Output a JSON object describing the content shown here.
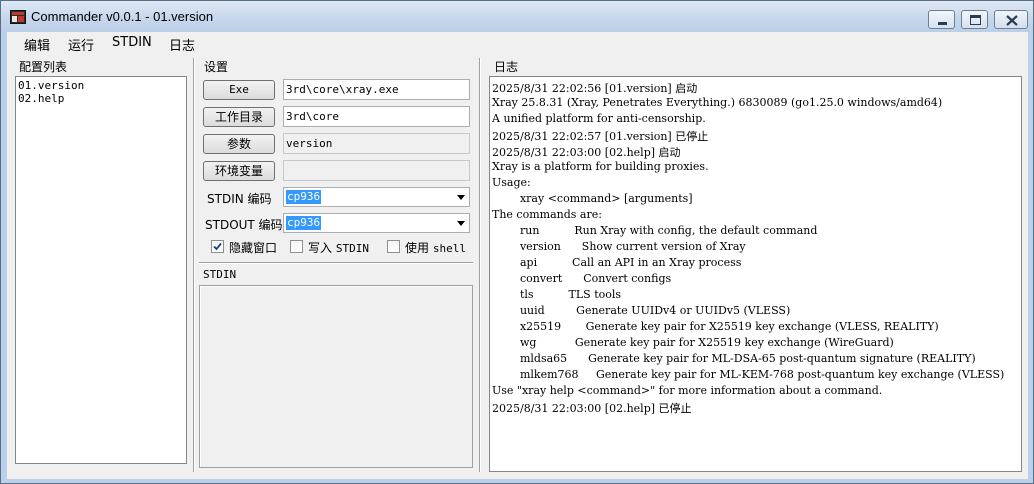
{
  "window": {
    "title": "Commander v0.0.1 - 01.version"
  },
  "menu": {
    "items": [
      "编辑",
      "运行",
      "STDIN",
      "日志"
    ]
  },
  "config_list": {
    "label": "配置列表",
    "items": [
      "01.version",
      "02.help"
    ]
  },
  "settings": {
    "label": "设置",
    "exe_button": "Exe",
    "exe_value": "3rd\\core\\xray.exe",
    "workdir_button": "工作目录",
    "workdir_value": "3rd\\core",
    "args_button": "参数",
    "args_value": "version",
    "env_button": "环境变量",
    "env_value": "",
    "stdin_encoding_label": "STDIN 编码",
    "stdin_encoding_value": "cp936",
    "stdout_encoding_label": "STDOUT 编码",
    "stdout_encoding_value": "cp936",
    "hide_window_label": "隐藏窗口",
    "hide_window_checked": true,
    "write_stdin_prefix": "写入",
    "write_stdin_suffix": "STDIN",
    "write_stdin_checked": false,
    "use_shell_prefix": "使用",
    "use_shell_suffix": "shell",
    "use_shell_checked": false
  },
  "stdin": {
    "label": "STDIN",
    "value": ""
  },
  "log": {
    "label": "日志",
    "lines": [
      "2025/8/31 22:02:56 [01.version] 启动",
      "Xray 25.8.31 (Xray, Penetrates Everything.) 6830089 (go1.25.0 windows/amd64)",
      "A unified platform for anti-censorship.",
      "2025/8/31 22:02:57 [01.version] 已停止",
      "2025/8/31 22:03:00 [02.help] 启动",
      "Xray is a platform for building proxies.",
      "Usage:",
      "        xray <command> [arguments]",
      "The commands are:",
      "        run          Run Xray with config, the default command",
      "        version      Show current version of Xray",
      "        api          Call an API in an Xray process",
      "        convert      Convert configs",
      "        tls          TLS tools",
      "        uuid         Generate UUIDv4 or UUIDv5 (VLESS)",
      "        x25519       Generate key pair for X25519 key exchange (VLESS, REALITY)",
      "        wg           Generate key pair for X25519 key exchange (WireGuard)",
      "        mldsa65      Generate key pair for ML-DSA-65 post-quantum signature (REALITY)",
      "        mlkem768     Generate key pair for ML-KEM-768 post-quantum key exchange (VLESS)",
      "Use \"xray help <command>\" for more information about a command.",
      "2025/8/31 22:03:00 [02.help] 已停止"
    ]
  }
}
